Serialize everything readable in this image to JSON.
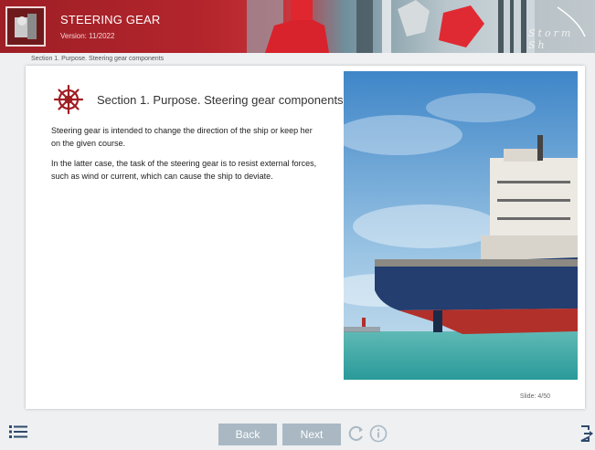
{
  "header": {
    "title": "STEERING GEAR",
    "version": "Version: 11/2022",
    "signature": "Storm Sh"
  },
  "breadcrumb": "Section 1. Purpose. Steering gear components",
  "content": {
    "heading": "Section 1. Purpose. Steering gear components",
    "paragraphs": [
      "Steering gear is intended to change the direction of the ship or keep her on the given course.",
      "In the latter case, the task of the steering gear is to resist external forces, such as wind or current, which can cause the ship to deviate."
    ],
    "slide_counter": "Slide: 4/50"
  },
  "footer": {
    "back_label": "Back",
    "next_label": "Next"
  },
  "icons": {
    "menu": "menu-list-icon",
    "refresh": "refresh-icon",
    "info": "info-icon",
    "exit": "exit-icon",
    "helm": "ship-wheel-icon"
  },
  "colors": {
    "brand_red": "#b4252c",
    "button_gray": "#a9b8c3"
  }
}
